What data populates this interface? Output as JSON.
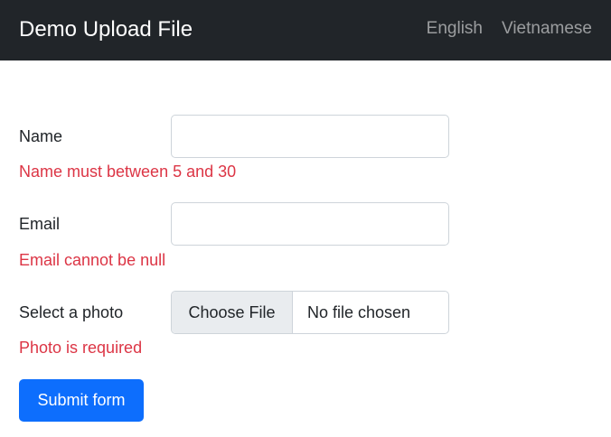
{
  "navbar": {
    "brand": "Demo Upload File",
    "links": [
      "English",
      "Vietnamese"
    ]
  },
  "form": {
    "name": {
      "label": "Name",
      "value": "",
      "error": "Name must between 5 and 30"
    },
    "email": {
      "label": "Email",
      "value": "",
      "error": "Email cannot be null"
    },
    "photo": {
      "label": "Select a photo",
      "button": "Choose File",
      "status": "No file chosen",
      "error": "Photo is required"
    },
    "submit_label": "Submit form"
  },
  "colors": {
    "navbar_bg": "#212529",
    "error": "#dc3545",
    "primary": "#0d6efd"
  }
}
